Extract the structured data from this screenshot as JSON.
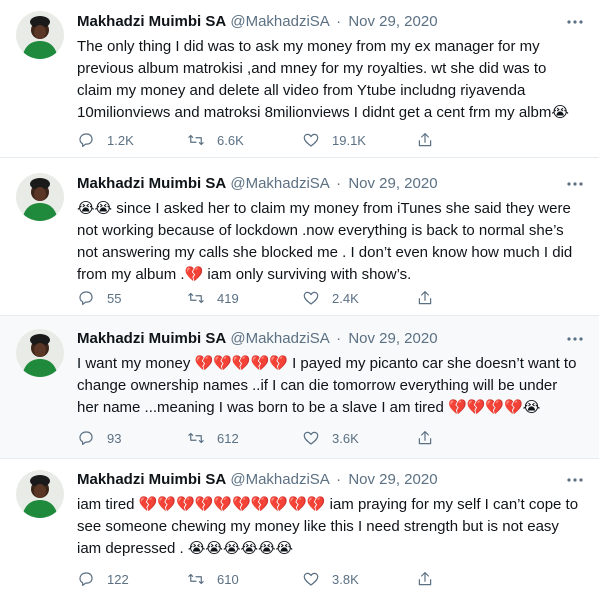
{
  "colors": {
    "text": "#0f1419",
    "secondary": "#5b7083",
    "divider": "#e6ecf0",
    "highlight_bg": "#f7f9fa",
    "avatar_dress": "#1f8a3c"
  },
  "icons": {
    "more": "more-horizontal-icon",
    "reply": "reply-icon",
    "retweet": "retweet-icon",
    "like": "heart-icon",
    "share": "share-icon"
  },
  "tweets": [
    {
      "name": "Makhadzi Muimbi SA",
      "handle": "@MakhadziSA",
      "separator": "·",
      "date": "Nov 29, 2020",
      "text": "The only thing I did was to ask my money from my ex manager for my previous album matrokisi ,and  mney for my royalties. wt she did was to claim my money and delete all video from Ytube includng riyavenda 10milionviews and matroksi 8milionviews I didnt get a cent frm my albm😭",
      "replies": "1.2K",
      "retweets": "6.6K",
      "likes": "19.1K"
    },
    {
      "name": "Makhadzi Muimbi SA",
      "handle": "@MakhadziSA",
      "separator": "·",
      "date": "Nov 29, 2020",
      "text": "😭😭 since I asked her to claim my money from iTunes she said they were not working because of lockdown .now everything is back to normal she’s not answering my calls she blocked me . I don’t even know how much I did from my album .💔 iam only surviving with show’s.",
      "replies": "55",
      "retweets": "419",
      "likes": "2.4K"
    },
    {
      "name": "Makhadzi Muimbi SA",
      "handle": "@MakhadziSA",
      "separator": "·",
      "date": "Nov 29, 2020",
      "text": "I want my money 💔💔💔💔💔 I payed my picanto car she doesn’t want to change ownership names ..if I can die tomorrow everything will be under her name ...meaning I was born to be a slave I am tired 💔💔💔💔😭",
      "replies": "93",
      "retweets": "612",
      "likes": "3.6K"
    },
    {
      "name": "Makhadzi Muimbi SA",
      "handle": "@MakhadziSA",
      "separator": "·",
      "date": "Nov 29, 2020",
      "text": "iam tired 💔💔💔💔💔💔💔💔💔💔 iam praying for my self I can’t cope to see someone chewing my money like this  I need strength but is not easy iam depressed . 😭😭😭😭😭😭",
      "replies": "122",
      "retweets": "610",
      "likes": "3.8K"
    }
  ]
}
